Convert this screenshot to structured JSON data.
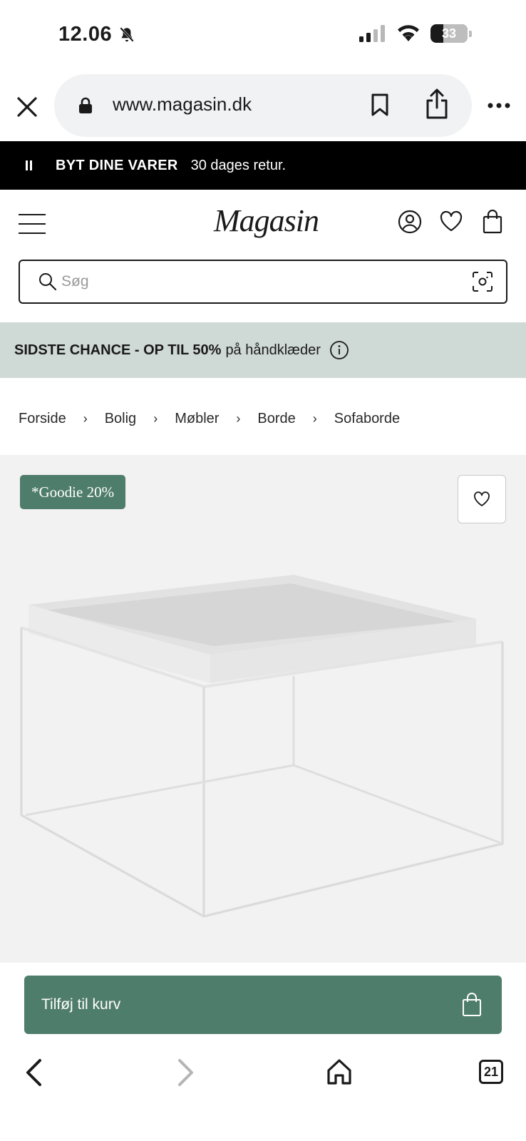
{
  "status": {
    "time": "12.06",
    "battery": "33"
  },
  "browser": {
    "url": "www.magasin.dk",
    "tab_count": "21"
  },
  "announcement": {
    "bold": "BYT DINE VARER",
    "text": "30 dages retur."
  },
  "header": {
    "logo": "Magasin"
  },
  "search": {
    "placeholder": "Søg"
  },
  "promo": {
    "bold": "SIDSTE CHANCE - OP TIL 50%",
    "text": "på håndklæder"
  },
  "breadcrumb": [
    "Forside",
    "Bolig",
    "Møbler",
    "Borde",
    "Sofaborde"
  ],
  "breadcrumb_separator": "›",
  "product": {
    "badge": "*Goodie 20%"
  },
  "cart": {
    "label": "Tilføj til kurv"
  },
  "colors": {
    "accent_green": "#4f7d6b",
    "promo_bg": "#cfd9d6",
    "announce_bg": "#000000"
  }
}
